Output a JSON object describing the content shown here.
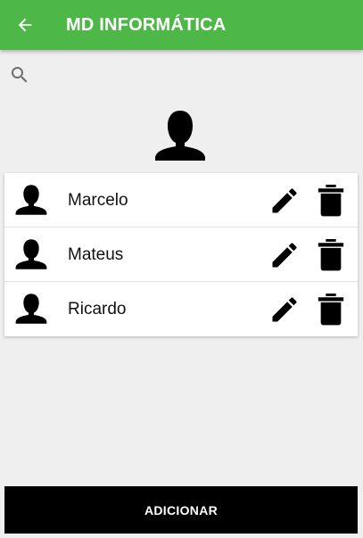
{
  "app_bar": {
    "title": "MD INFORMÁTICA",
    "background_color": "#4db848",
    "back_icon": "arrow-left-icon"
  },
  "search": {
    "icon": "search-icon"
  },
  "header_avatar": {
    "icon": "person-icon"
  },
  "contacts": [
    {
      "name": "Marcelo",
      "avatar_icon": "person-icon",
      "edit_icon": "pencil-icon",
      "delete_icon": "trash-icon"
    },
    {
      "name": "Mateus",
      "avatar_icon": "person-icon",
      "edit_icon": "pencil-icon",
      "delete_icon": "trash-icon"
    },
    {
      "name": "Ricardo",
      "avatar_icon": "person-icon",
      "edit_icon": "pencil-icon",
      "delete_icon": "trash-icon"
    }
  ],
  "add_button": {
    "label": "ADICIONAR",
    "background_color": "#000000"
  }
}
